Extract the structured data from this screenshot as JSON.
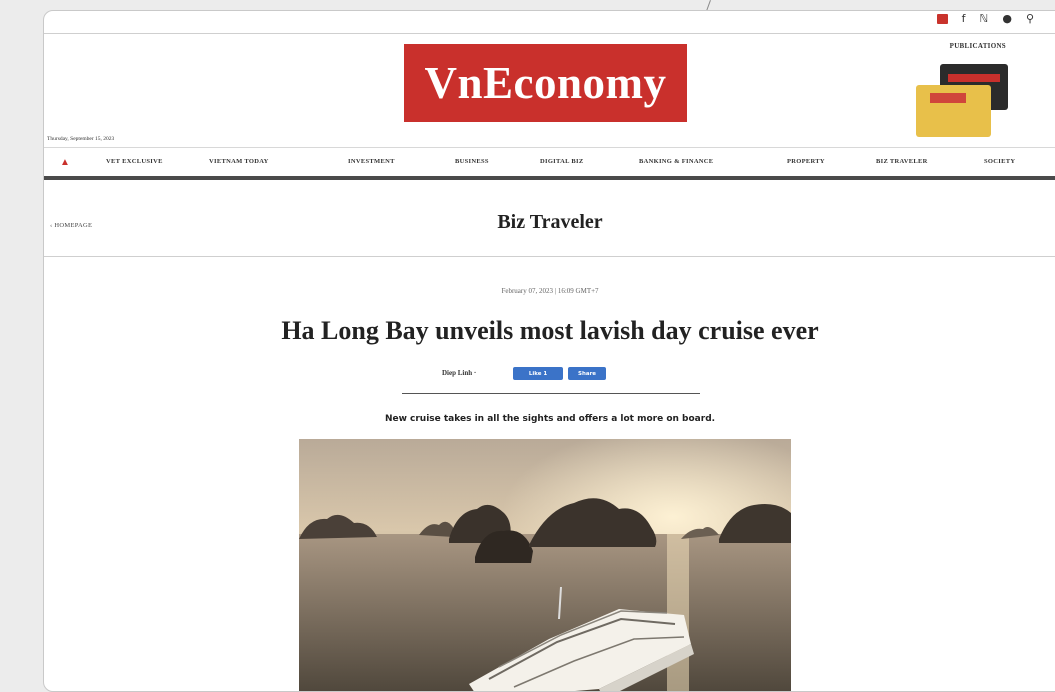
{
  "header": {
    "logo": "VnEconomy",
    "date": "Thursday, September 15, 2023",
    "publications_label": "PUBLICATIONS",
    "social_icons": [
      "youtube-icon",
      "facebook-icon",
      "rss-icon",
      "user-icon",
      "search-icon"
    ]
  },
  "nav": {
    "home_icon": "home-icon",
    "items": [
      "VET EXCLUSIVE",
      "VIETNAM TODAY",
      "INVESTMENT",
      "BUSINESS",
      "DIGITAL BIZ",
      "BANKING & FINANCE",
      "PROPERTY",
      "BIZ TRAVELER",
      "SOCIETY"
    ]
  },
  "section": {
    "back_label": "HOMEPAGE",
    "title": "Biz Traveler"
  },
  "article": {
    "date": "February 07, 2023 | 16:09 GMT+7",
    "headline": "Ha Long Bay unveils most lavish day cruise ever",
    "author": "Diep Linh ·",
    "like_label": "Like 1",
    "share_label": "Share",
    "lead": "New cruise takes in all the sights and offers a lot more on board."
  },
  "colors": {
    "brand": "#c9302c",
    "facebook": "#3b73c8"
  }
}
